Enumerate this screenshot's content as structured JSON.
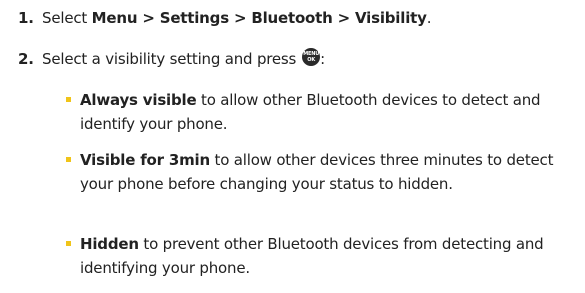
{
  "steps": [
    {
      "number": "1.",
      "prefix": "Select ",
      "bold": "Menu > Settings > Bluetooth > Visibility",
      "suffix": "."
    },
    {
      "number": "2.",
      "text": "Select a visibility setting and press",
      "suffix": ":",
      "key": {
        "icon": "menu-ok-key-icon",
        "line1": "MENU",
        "line2": "OK"
      }
    }
  ],
  "options": [
    {
      "bold": "Always visible",
      "text": " to allow other Bluetooth devices to detect and identify your phone."
    },
    {
      "bold": "Visible for 3min",
      "text": " to allow other devices three minutes to detect your phone before changing your status to hidden."
    },
    {
      "bold": "Hidden",
      "text": " to prevent other Bluetooth devices from detecting and identifying your phone."
    }
  ],
  "colors": {
    "bullet": "#f0c419",
    "text": "#222222",
    "key": "#2a2a2a"
  }
}
